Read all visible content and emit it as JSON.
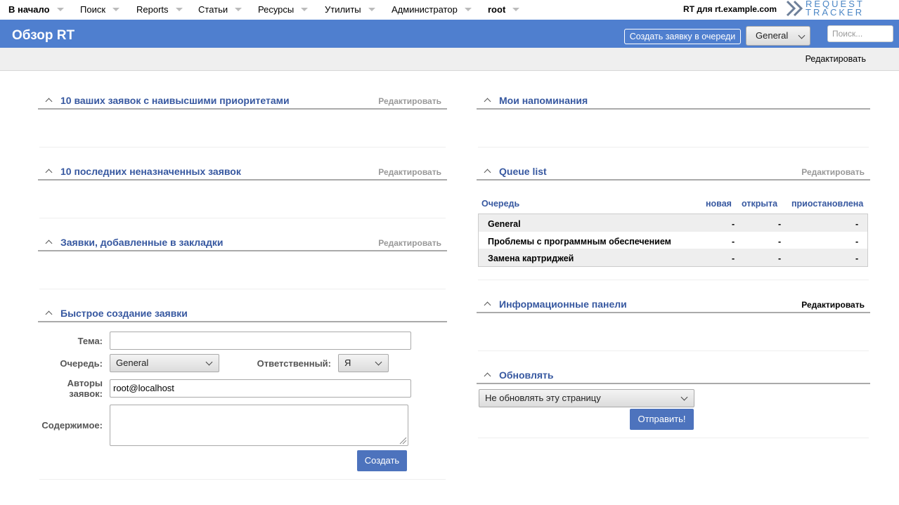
{
  "nav": {
    "items": [
      {
        "label": "В начало"
      },
      {
        "label": "Поиск"
      },
      {
        "label": "Reports"
      },
      {
        "label": "Статьи"
      },
      {
        "label": "Ресурсы"
      },
      {
        "label": "Утилиты"
      },
      {
        "label": "Администратор"
      },
      {
        "label": "root"
      }
    ],
    "rt_for": "RT для rt.example.com",
    "logo_line1": "REQUEST",
    "logo_line2": "TRACKER"
  },
  "header": {
    "title": "Обзор RT",
    "create_button": "Создать заявку в очереди",
    "queue_select": "General",
    "search_placeholder": "Поиск..."
  },
  "subbar": {
    "edit": "Редактировать"
  },
  "panels": {
    "top_priority": {
      "title": "10 ваших заявок с наивысшими приоритетами",
      "edit": "Редактировать"
    },
    "unowned": {
      "title": "10 последних неназначенных заявок",
      "edit": "Редактировать"
    },
    "bookmarked": {
      "title": "Заявки, добавленные в закладки",
      "edit": "Редактировать"
    },
    "quick_create": {
      "title": "Быстрое создание заявки"
    },
    "reminders": {
      "title": "Мои напоминания"
    },
    "queue_list": {
      "title": "Queue list",
      "edit": "Редактировать"
    },
    "dashboards": {
      "title": "Информационные панели",
      "edit": "Редактировать"
    },
    "refresh": {
      "title": "Обновлять"
    }
  },
  "queue_table": {
    "headers": [
      "Очередь",
      "новая",
      "открыта",
      "приостановлена"
    ],
    "rows": [
      {
        "name": "General",
        "new": "-",
        "open": "-",
        "stalled": "-"
      },
      {
        "name": "Проблемы с программным обеспечением",
        "new": "-",
        "open": "-",
        "stalled": "-"
      },
      {
        "name": "Замена картриджей",
        "new": "-",
        "open": "-",
        "stalled": "-"
      }
    ]
  },
  "quick_form": {
    "subject_label": "Тема:",
    "subject_value": "",
    "queue_label": "Очередь:",
    "queue_value": "General",
    "owner_label": "Ответственный:",
    "owner_value": "Я",
    "requestors_label_1": "Авторы",
    "requestors_label_2": "заявок:",
    "requestors_value": "root@localhost",
    "content_label": "Содержимое:",
    "submit": "Создать"
  },
  "refresh_form": {
    "select_value": "Не обновлять эту страницу",
    "submit": "Отправить!"
  }
}
